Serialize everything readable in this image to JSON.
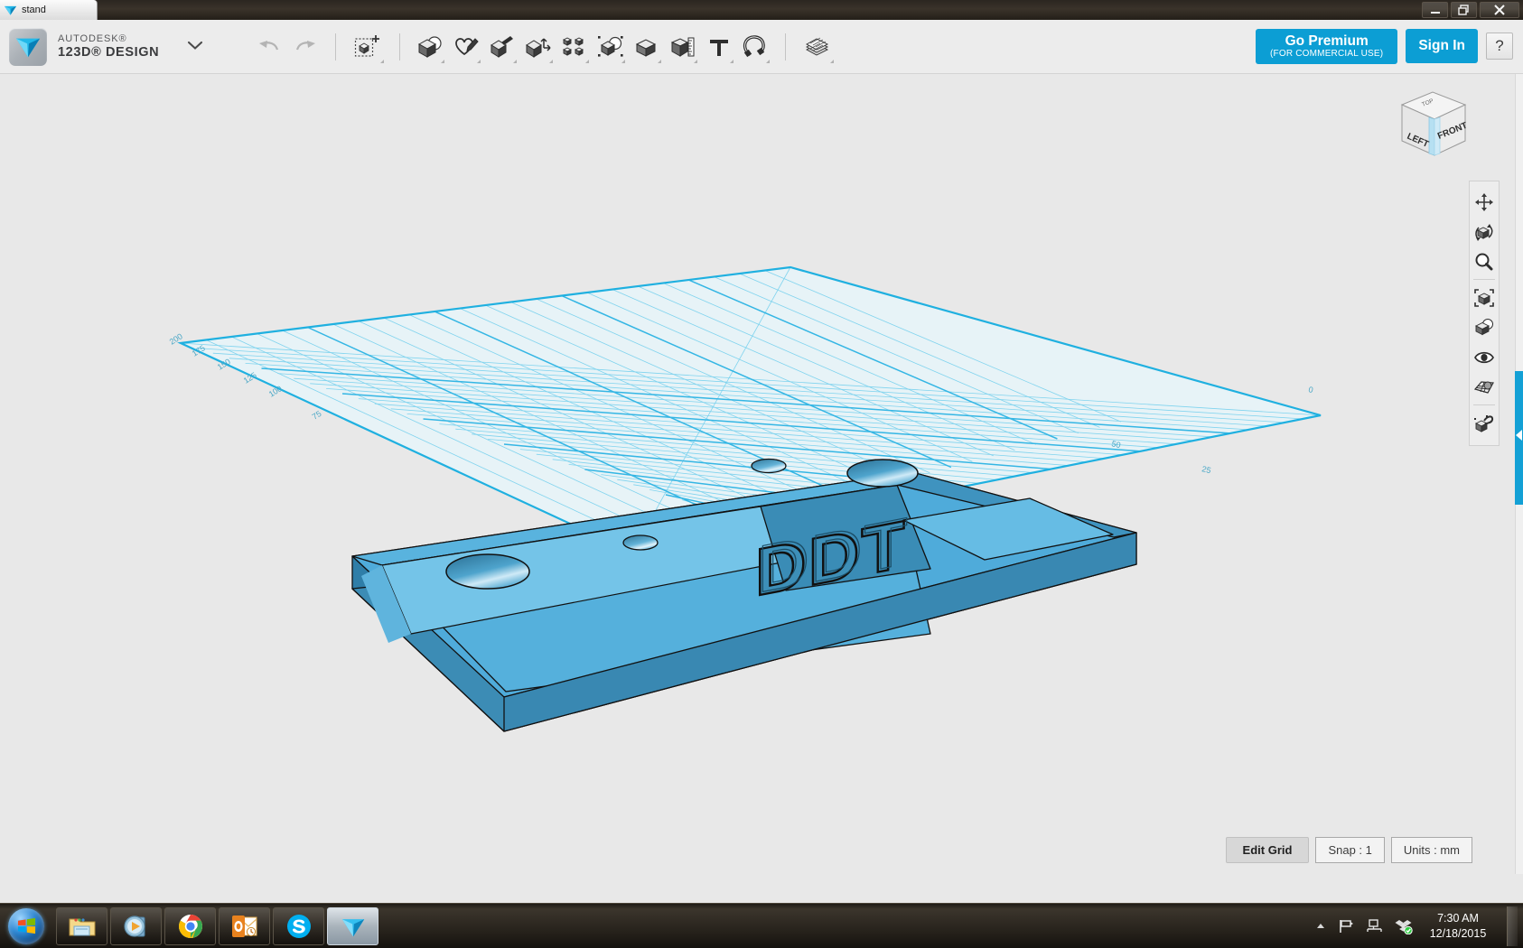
{
  "window": {
    "tab_title": "stand",
    "controls": {
      "minimize": "minimize-icon",
      "restore": "restore-icon",
      "close": "close-icon"
    }
  },
  "app": {
    "brand_line1": "AUTODESK®",
    "brand_line2": "123D® DESIGN",
    "menu_caret": "chevron-down-icon",
    "history_tools": [
      {
        "name": "undo-button",
        "icon": "undo-arrow-icon",
        "label": "Undo",
        "enabled": false
      },
      {
        "name": "redo-button",
        "icon": "redo-arrow-icon",
        "label": "Redo",
        "enabled": false
      }
    ],
    "transform_tool": {
      "name": "transform-button",
      "icon": "move-cube-icon",
      "label": "Transform"
    },
    "main_tools": [
      {
        "name": "primitives-button",
        "icon": "cube-sphere-icon",
        "label": "Primitives"
      },
      {
        "name": "sketch-button",
        "icon": "sketch-pen-icon",
        "label": "Sketch"
      },
      {
        "name": "construct-button",
        "icon": "construct-brush-icon",
        "label": "Construct"
      },
      {
        "name": "modify-button",
        "icon": "modify-cube-arrow-icon",
        "label": "Modify"
      },
      {
        "name": "pattern-button",
        "icon": "pattern-grid-icon",
        "label": "Pattern"
      },
      {
        "name": "grouping-button",
        "icon": "grouping-dashed-icon",
        "label": "Grouping"
      },
      {
        "name": "combine-button",
        "icon": "combine-cube-icon",
        "label": "Combine"
      },
      {
        "name": "measure-button",
        "icon": "measure-ruler-icon",
        "label": "Measure"
      },
      {
        "name": "text-button",
        "icon": "text-T-icon",
        "label": "Text"
      },
      {
        "name": "snap-button",
        "icon": "magnet-icon",
        "label": "Snap"
      }
    ],
    "material_tool": {
      "name": "material-button",
      "icon": "layers-stack-icon",
      "label": "Material"
    },
    "premium_line1": "Go Premium",
    "premium_line2": "(FOR COMMERCIAL USE)",
    "signin_label": "Sign In",
    "help_label": "?"
  },
  "viewcube": {
    "face_left": "LEFT",
    "face_front": "FRONT",
    "face_top": "TOP"
  },
  "nav_tools": [
    {
      "name": "pan-tool",
      "icon": "pan-arrows-icon",
      "label": "Pan"
    },
    {
      "name": "orbit-tool",
      "icon": "orbit-cube-icon",
      "label": "Orbit"
    },
    {
      "name": "zoom-tool",
      "icon": "magnifier-icon",
      "label": "Zoom"
    },
    {
      "name": "fit-tool",
      "icon": "fit-to-view-icon",
      "label": "Fit"
    },
    {
      "name": "shading-tool",
      "icon": "shaded-cube-icon",
      "label": "Display / Shading"
    },
    {
      "name": "visibility-tool",
      "icon": "eye-icon",
      "label": "Visibility"
    },
    {
      "name": "grid-tool",
      "icon": "grid-view-icon",
      "label": "Grid / Snap View"
    },
    {
      "name": "material-paint-tool",
      "icon": "paint-cube-icon",
      "label": "Material"
    }
  ],
  "statusbar": {
    "edit_grid_label": "Edit Grid",
    "snap_label": "Snap  :  1",
    "units_label": "Units : mm"
  },
  "scene": {
    "model_text": "DDT",
    "grid_axis_labels": [
      "200",
      "175",
      "150",
      "125",
      "100",
      "75"
    ],
    "grid_far_labels": [
      "50",
      "25",
      "0"
    ],
    "colors": {
      "model_top": "#4aa8d8",
      "model_side": "#3889b4",
      "model_dark": "#2f7ba4",
      "grid_line": "#29b2e0",
      "grid_fill": "#e3f2f8",
      "canvas_bg": "#e8e8e8",
      "accent": "#0c9ed4"
    }
  },
  "taskbar": {
    "start": {
      "name": "start-button",
      "icon": "windows-orb-icon",
      "label": "Start"
    },
    "items": [
      {
        "name": "taskbar-explorer",
        "icon": "folder-explorer-icon",
        "label": "Windows Explorer",
        "active": false
      },
      {
        "name": "taskbar-media-player",
        "icon": "media-player-icon",
        "label": "Windows Media Player",
        "active": false
      },
      {
        "name": "taskbar-chrome",
        "icon": "chrome-icon",
        "label": "Google Chrome",
        "active": false
      },
      {
        "name": "taskbar-outlook",
        "icon": "outlook-icon",
        "label": "Microsoft Outlook",
        "active": false
      },
      {
        "name": "taskbar-skype",
        "icon": "skype-icon",
        "label": "Skype",
        "active": false
      },
      {
        "name": "taskbar-123d-design",
        "icon": "123d-design-icon",
        "label": "123D Design",
        "active": true
      }
    ],
    "tray": [
      {
        "name": "tray-show-hidden",
        "icon": "chevron-up-icon"
      },
      {
        "name": "tray-action-center",
        "icon": "flag-icon"
      },
      {
        "name": "tray-network",
        "icon": "network-icon"
      },
      {
        "name": "tray-dropbox",
        "icon": "dropbox-sync-icon"
      }
    ],
    "clock_time": "7:30 AM",
    "clock_date": "12/18/2015"
  }
}
